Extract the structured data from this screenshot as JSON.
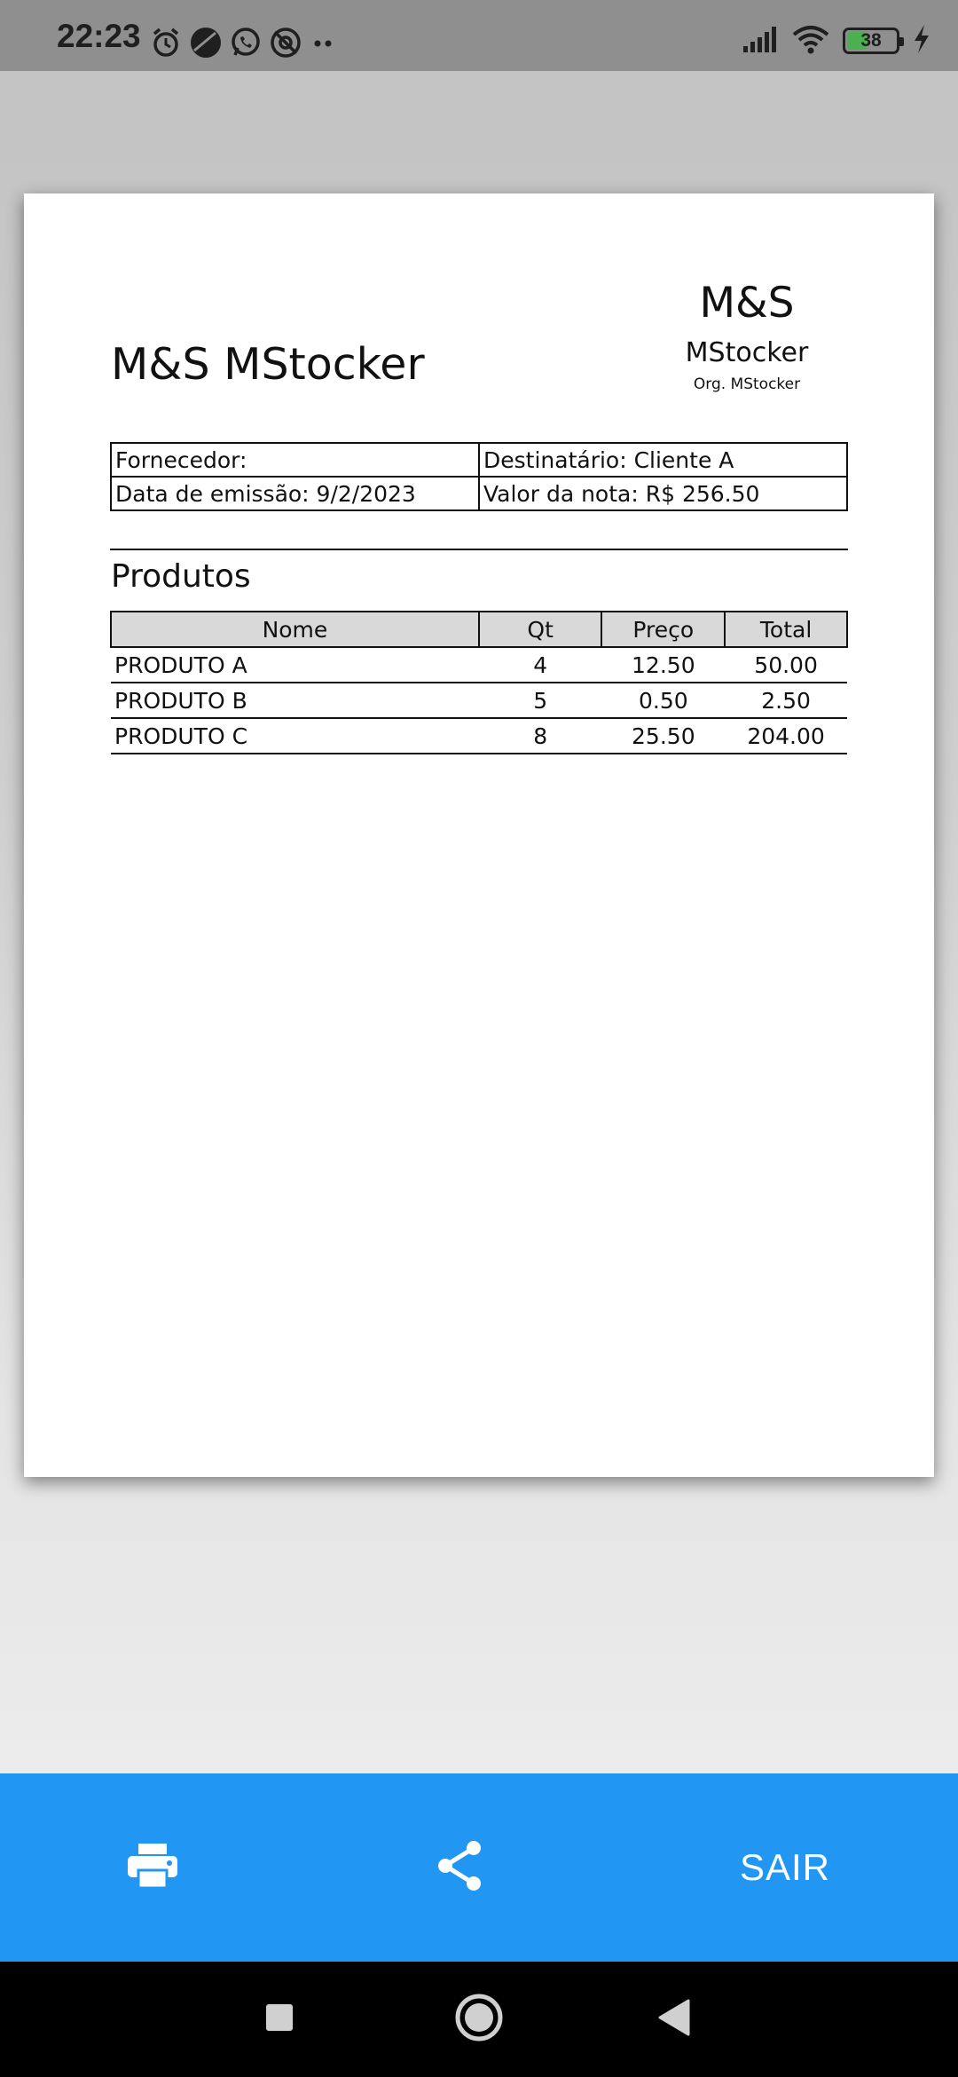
{
  "status_bar": {
    "time": "22:23",
    "battery_level": "38",
    "icons": [
      "alarm-icon",
      "app-icon",
      "whatsapp-icon",
      "at-sign-icon",
      "more-dots-icon",
      "signal-icon",
      "wifi-icon",
      "battery-icon",
      "charging-icon"
    ]
  },
  "document": {
    "title": "M&S MStocker",
    "org": {
      "logo_text": "M&S",
      "name": "MStocker",
      "sub": "Org. MStocker"
    },
    "info": {
      "supplier": "Fornecedor:",
      "recipient": "Destinatário: Cliente A",
      "issue_date": "Data de emissão: 9/2/2023",
      "invoice_value": "Valor da nota: R$ 256.50"
    },
    "products_title": "Produtos",
    "products_columns": [
      "Nome",
      "Qt",
      "Preço",
      "Total"
    ],
    "products": [
      {
        "name": "PRODUTO A",
        "qty": "4",
        "price": "12.50",
        "total": "50.00"
      },
      {
        "name": "PRODUTO B",
        "qty": "5",
        "price": "0.50",
        "total": "2.50"
      },
      {
        "name": "PRODUTO C",
        "qty": "8",
        "price": "25.50",
        "total": "204.00"
      }
    ]
  },
  "action_bar": {
    "print_icon": "print-icon",
    "share_icon": "share-icon",
    "exit_label": "SAIR",
    "color": "#2196f3"
  },
  "nav_bar": {
    "icons": [
      "recents-square-icon",
      "home-circle-icon",
      "back-triangle-icon"
    ]
  }
}
